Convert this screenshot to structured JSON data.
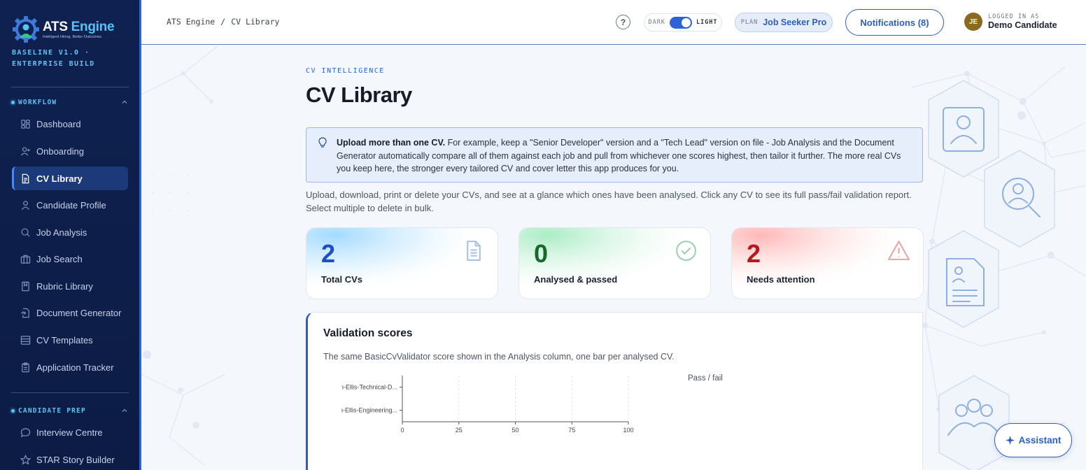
{
  "brand": {
    "name_a": "ATS ",
    "name_b": "Engine",
    "tagline": "Intelligent Hiring. Better Outcomes.",
    "build": "BASELINE V1.0 · ENTERPRISE BUILD"
  },
  "sidebar": {
    "workflow_label": "WORKFLOW",
    "workflow_items": [
      {
        "label": "Dashboard",
        "icon": "grid-icon"
      },
      {
        "label": "Onboarding",
        "icon": "user-plus-icon"
      },
      {
        "label": "CV Library",
        "icon": "document-icon",
        "active": true
      },
      {
        "label": "Candidate Profile",
        "icon": "user-icon"
      },
      {
        "label": "Job Analysis",
        "icon": "search-icon"
      },
      {
        "label": "Job Search",
        "icon": "briefcase-icon"
      },
      {
        "label": "Rubric Library",
        "icon": "bookmark-icon"
      },
      {
        "label": "Document Generator",
        "icon": "file-export-icon"
      },
      {
        "label": "CV Templates",
        "icon": "template-icon"
      },
      {
        "label": "Application Tracker",
        "icon": "clipboard-icon"
      }
    ],
    "prep_label": "CANDIDATE PREP",
    "prep_items": [
      {
        "label": "Interview Centre",
        "icon": "chat-icon"
      },
      {
        "label": "STAR Story Builder",
        "icon": "star-icon"
      }
    ]
  },
  "topbar": {
    "breadcrumb_root": "ATS Engine",
    "breadcrumb_sep": "/",
    "breadcrumb_current": "CV Library",
    "help_label": "?",
    "theme_dark": "DARK",
    "theme_light": "LIGHT",
    "plan_key": "PLAN",
    "plan_value": "Job Seeker Pro",
    "notifications": "Notifications (8)",
    "user_initials": "JE",
    "user_key": "LOGGED IN AS",
    "user_name": "Demo Candidate"
  },
  "page": {
    "eyebrow": "CV INTELLIGENCE",
    "title": "CV Library",
    "tip_bold": "Upload more than one CV.",
    "tip_text": " For example, keep a \"Senior Developer\" version and a \"Tech Lead\" version on file - Job Analysis and the Document Generator automatically compare all of them against each job and pull from whichever one scores highest, then tailor it further. The more real CVs you keep here, the stronger every tailored CV and cover letter this app produces for you.",
    "lead": "Upload, download, print or delete your CVs, and see at a glance which ones have been analysed. Click any CV to see its full pass/fail validation report. Select multiple to delete in bulk."
  },
  "stats": [
    {
      "value": "2",
      "label": "Total CVs",
      "color": "#1f4fc4",
      "icon": "document-icon"
    },
    {
      "value": "0",
      "label": "Analysed & passed",
      "color": "#17692f",
      "icon": "check-circle-icon"
    },
    {
      "value": "2",
      "label": "Needs attention",
      "color": "#b3191f",
      "icon": "warning-icon"
    }
  ],
  "panel": {
    "title": "Validation scores",
    "subtitle": "The same BasicCvValidator score shown in the Analysis column, one bar per analysed CV."
  },
  "chart_data": {
    "type": "bar",
    "orientation": "horizontal",
    "categories": [
      "Jordan-Ellis-Technical-D...",
      "Jordan-Ellis-Engineering..."
    ],
    "series": [
      {
        "name": "Pass / fail",
        "values": [
          0,
          0
        ]
      }
    ],
    "xticks": [
      "0",
      "25",
      "50",
      "75",
      "100"
    ],
    "xlim": [
      0,
      100
    ],
    "legend": "top-right",
    "grid": "vertical-dashed"
  },
  "assistant": {
    "label": "Assistant"
  }
}
